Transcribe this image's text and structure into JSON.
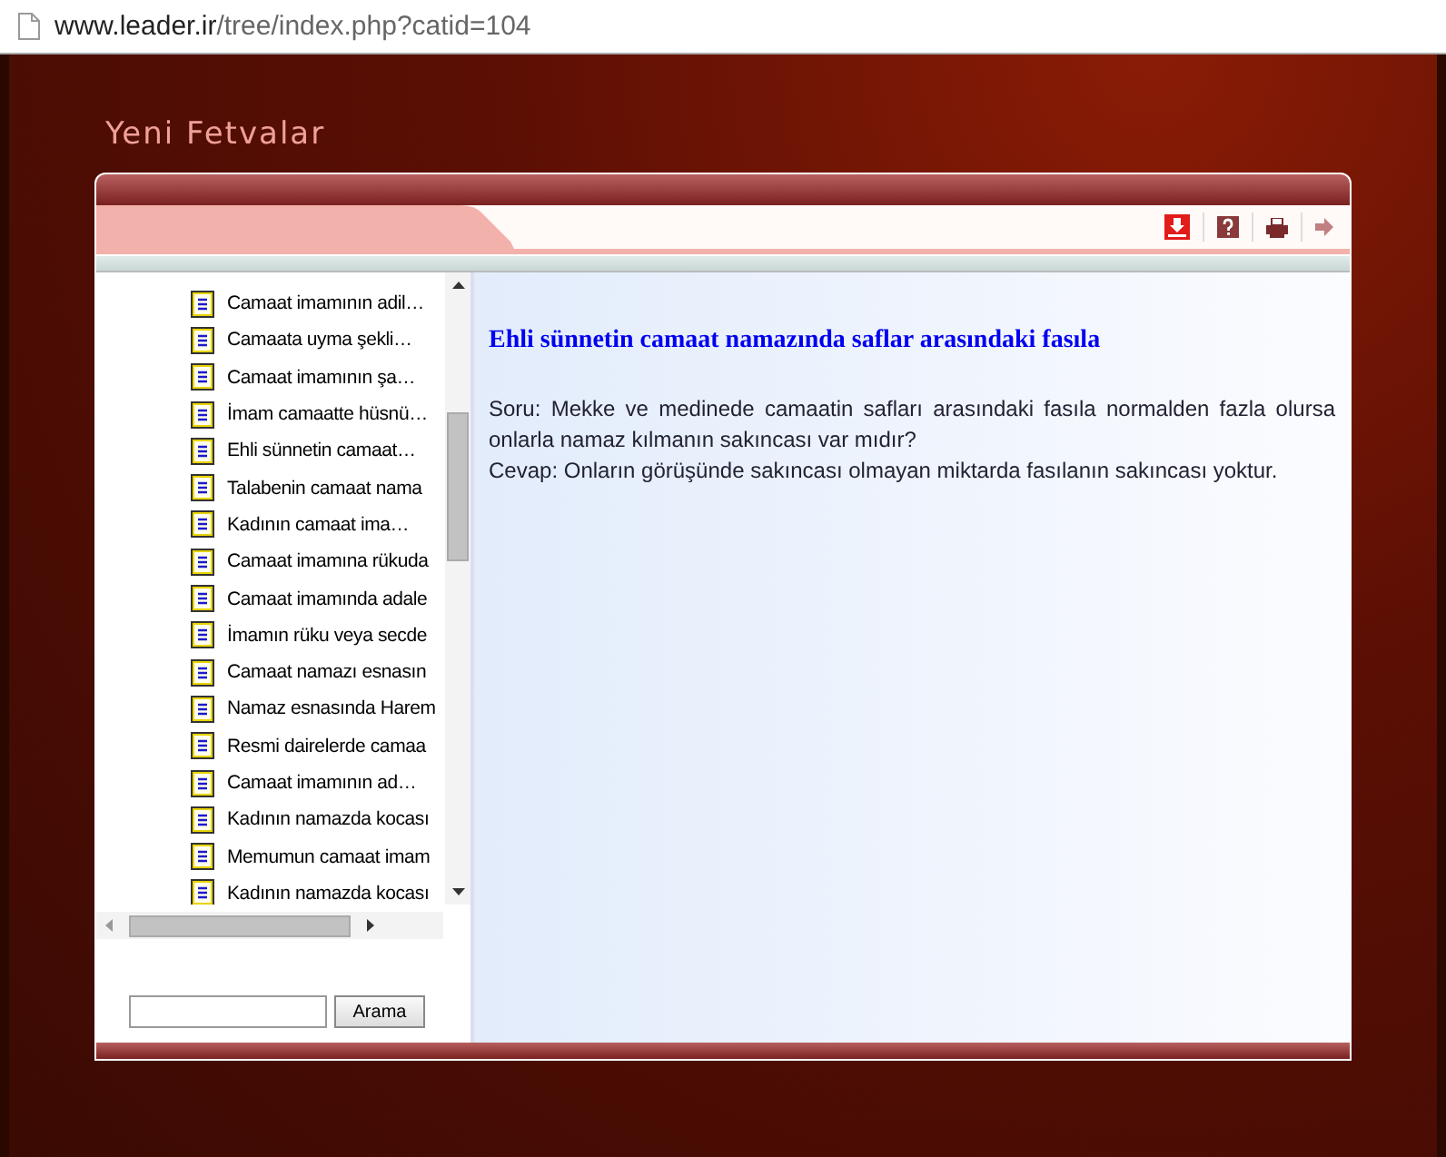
{
  "address_bar": {
    "url_host": "www.leader.ir",
    "url_path": "/tree/index.php?catid=104"
  },
  "page_title": "Yeni Fetvalar",
  "tree": {
    "items": [
      {
        "label": "Camaat imamının adil…"
      },
      {
        "label": "Camaata uyma şekli…"
      },
      {
        "label": "Camaat imamının şa…"
      },
      {
        "label": "İmam camaatte hüsnü…"
      },
      {
        "label": "Ehli sünnetin camaat…"
      },
      {
        "label": "Talabenin camaat nama"
      },
      {
        "label": "Kadının camaat ima…"
      },
      {
        "label": "Camaat imamına rükuda"
      },
      {
        "label": "Camaat imamında adale"
      },
      {
        "label": "İmamın rüku veya secde"
      },
      {
        "label": "Camaat namazı esnasın"
      },
      {
        "label": "Namaz esnasında Harem"
      },
      {
        "label": "Resmi dairelerde camaa"
      },
      {
        "label": "Camaat imamının ad…"
      },
      {
        "label": "Kadının namazda kocası"
      },
      {
        "label": "Memumun camaat imam"
      },
      {
        "label": "Kadının namazda kocası"
      }
    ]
  },
  "search": {
    "button": "Arama"
  },
  "article": {
    "title": "Ehli sünnetin camaat namazında saflar arasındaki fasıla",
    "question": "Soru: Mekke ve medinede camaatin safları arasındaki fasıla normalden fazla olursa onlarla namaz kılmanın sakıncası var mıdır?",
    "answer": "Cevap: Onların görüşünde sakıncası olmayan miktarda fasılanın sakıncası yoktur."
  }
}
